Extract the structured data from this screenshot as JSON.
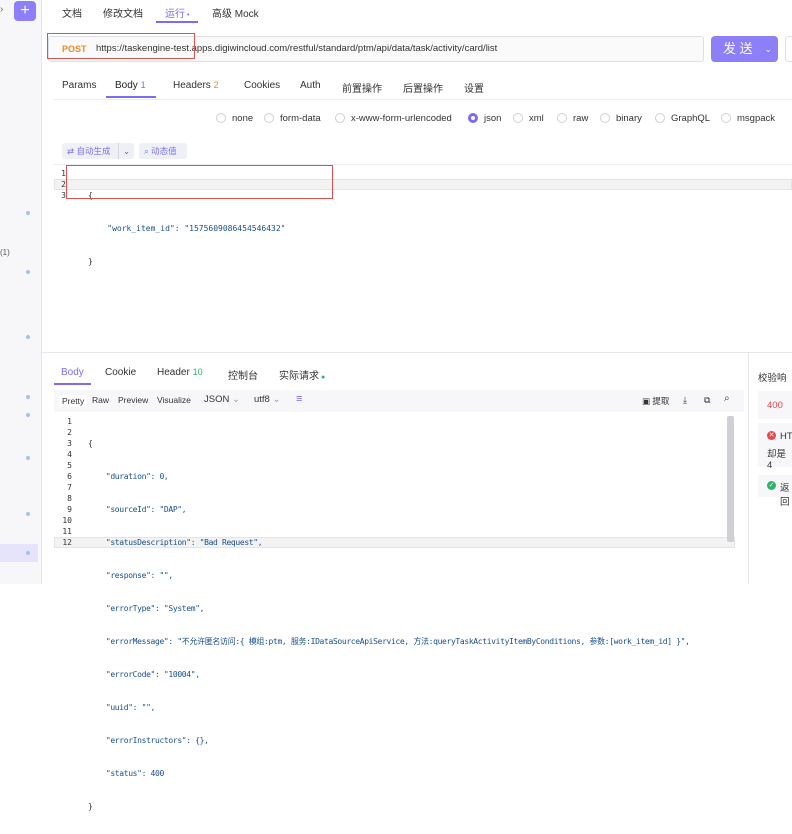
{
  "sidebar": {
    "count_label": "(1)",
    "add_icon": "+",
    "dots_color": "#a7c0ef"
  },
  "tabs": [
    {
      "label": "文档"
    },
    {
      "label": "修改文档"
    },
    {
      "label": "运行"
    },
    {
      "label": "高级 Mock"
    }
  ],
  "request": {
    "method": "POST",
    "url": "https://taskengine-test.apps.digiwincloud.com/restful/standard/ptm/api/data/task/activity/card/list",
    "send_label": "发 送"
  },
  "req_tabs": [
    {
      "label": "Params"
    },
    {
      "label": "Body",
      "count": "1"
    },
    {
      "label": "Headers",
      "count": "2"
    },
    {
      "label": "Cookies"
    },
    {
      "label": "Auth"
    },
    {
      "label": "前置操作"
    },
    {
      "label": "后置操作"
    },
    {
      "label": "设置"
    }
  ],
  "body_types": [
    {
      "label": "none"
    },
    {
      "label": "form-data"
    },
    {
      "label": "x-www-form-urlencoded"
    },
    {
      "label": "json",
      "selected": true
    },
    {
      "label": "xml"
    },
    {
      "label": "raw"
    },
    {
      "label": "binary"
    },
    {
      "label": "GraphQL"
    },
    {
      "label": "msgpack"
    }
  ],
  "editor_tools": {
    "auto_generate": "⇄ 自动生成",
    "dynamic_value": "⌕ 动态值"
  },
  "request_body": {
    "line_numbers": [
      "1",
      "2",
      "3"
    ],
    "lines": [
      "{",
      "    \"work_item_id\": \"1575609086454546432\"",
      "}"
    ]
  },
  "resp_tabs": [
    {
      "label": "Body"
    },
    {
      "label": "Cookie"
    },
    {
      "label": "Header",
      "count": "10"
    },
    {
      "label": "控制台"
    },
    {
      "label": "实际请求"
    }
  ],
  "resp_tools": {
    "pretty": "Pretty",
    "raw": "Raw",
    "preview": "Preview",
    "visualize": "Visualize",
    "format": "JSON",
    "encoding": "utf8",
    "extract": "提取"
  },
  "response_body": {
    "line_numbers": [
      "1",
      "2",
      "3",
      "4",
      "5",
      "6",
      "7",
      "8",
      "9",
      "10",
      "11",
      "12"
    ],
    "lines": [
      "{",
      "    \"duration\": 0,",
      "    \"sourceId\": \"DAP\",",
      "    \"statusDescription\": \"Bad Request\",",
      "    \"response\": \"\",",
      "    \"errorType\": \"System\",",
      "    \"errorMessage\": \"不允许匿名访问:{ 模组:ptm, 服务:IDataSourceApiService, 方法:queryTaskActivityItemByConditions, 参数:[work_item_id] }\",",
      "    \"errorCode\": \"10004\",",
      "    \"uuid\": \"\",",
      "    \"errorInstructors\": {},",
      "    \"status\": 400",
      "}"
    ]
  },
  "validation": {
    "title": "校验响",
    "status": "400",
    "error_text_1": "HT",
    "error_text_2": "却是 4",
    "ok_text": "返回"
  },
  "colors": {
    "accent": "#7b6cf6",
    "method": "#f08a24",
    "highlight_box": "#d9534f",
    "error": "#e5484d",
    "success": "#2fb36b"
  }
}
